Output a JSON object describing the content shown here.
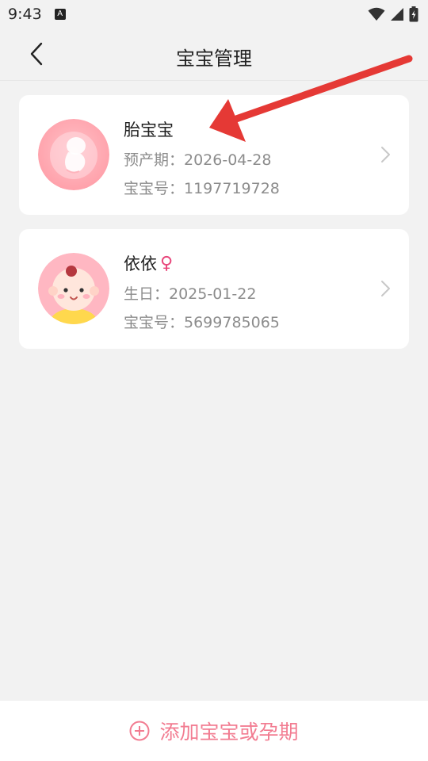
{
  "status_bar": {
    "time": "9:43",
    "notification_icon": "a-icon",
    "wifi_icon": "wifi-icon",
    "signal_icon": "signal-icon",
    "battery_icon": "battery-icon"
  },
  "header": {
    "title": "宝宝管理",
    "back_icon": "back-chevron-icon"
  },
  "babies": [
    {
      "name": "胎宝宝",
      "line1": "预产期：2026-04-28",
      "line2": "宝宝号：1197719728",
      "avatar": "fetus-avatar"
    },
    {
      "name": "依依",
      "gender_symbol": "♀",
      "line1": "生日：2025-01-22",
      "line2": "宝宝号：5699785065",
      "avatar": "baby-girl-avatar"
    }
  ],
  "footer": {
    "add_label": "添加宝宝或孕期"
  },
  "colors": {
    "accent": "#f27c91",
    "gender_female": "#e8457a",
    "annotation_arrow": "#e53935",
    "background": "#f2f2f2"
  }
}
